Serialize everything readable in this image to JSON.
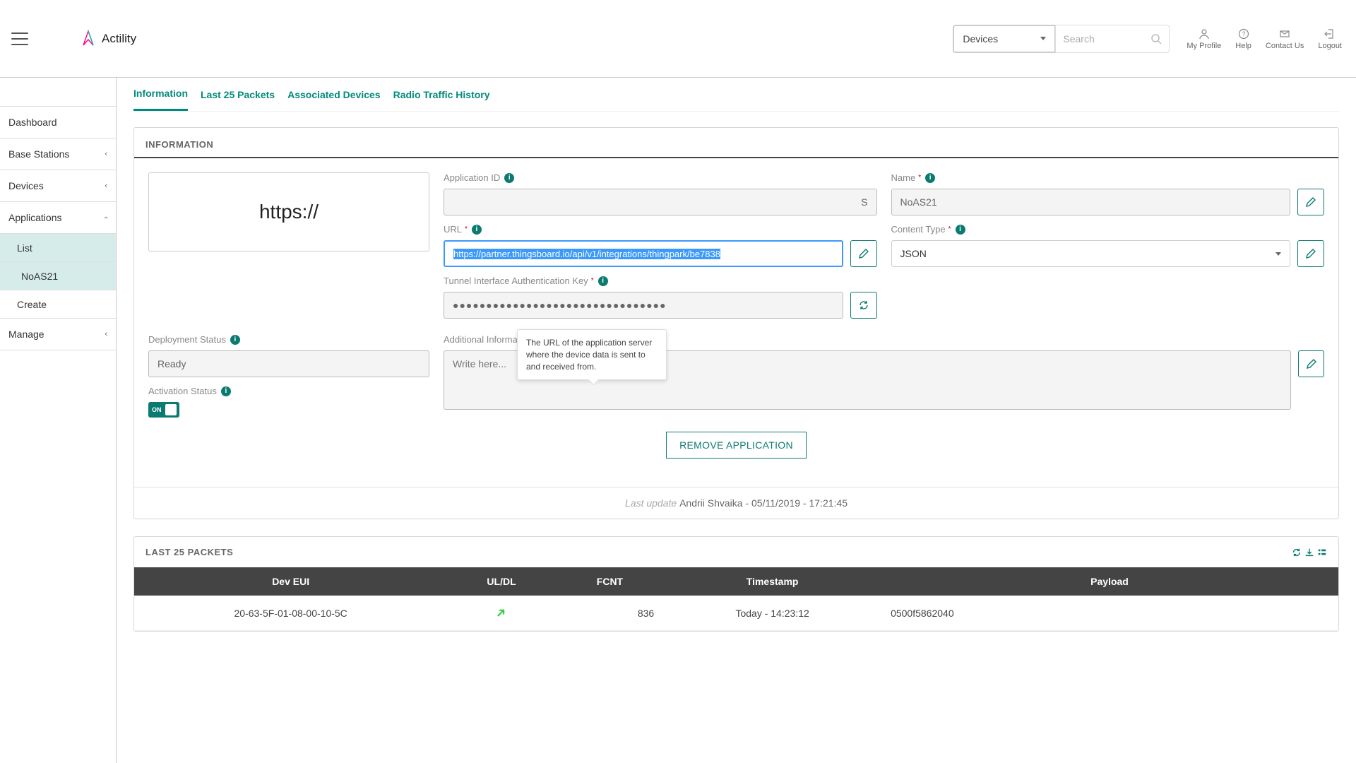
{
  "brand": "Actility",
  "topbar": {
    "device_select": "Devices",
    "search_placeholder": "Search",
    "actions": {
      "profile": "My Profile",
      "help": "Help",
      "contact": "Contact Us",
      "logout": "Logout"
    }
  },
  "sidebar": {
    "dashboard": "Dashboard",
    "base_stations": "Base Stations",
    "devices": "Devices",
    "applications": "Applications",
    "apps_sub": {
      "list": "List",
      "detail": "NoAS21",
      "create": "Create"
    },
    "manage": "Manage"
  },
  "tabs": {
    "information": "Information",
    "last25": "Last 25 Packets",
    "associated": "Associated Devices",
    "radio": "Radio Traffic History"
  },
  "info_panel": {
    "title": "INFORMATION",
    "protocol_label": "https://",
    "app_id_label": "Application ID",
    "app_id_value": "S",
    "name_label": "Name",
    "name_value": "NoAS21",
    "url_label": "URL",
    "url_value": "https://partner.thingsboard.io/api/v1/integrations/thingpark/be7838",
    "content_type_label": "Content Type",
    "content_type_value": "JSON",
    "tunnel_label": "Tunnel Interface Authentication Key",
    "tunnel_value": "●●●●●●●●●●●●●●●●●●●●●●●●●●●●●●●●",
    "deploy_label": "Deployment Status",
    "deploy_value": "Ready",
    "activation_label": "Activation Status",
    "activation_toggle": "ON",
    "additional_label": "Additional Information",
    "additional_placeholder": "Write here...",
    "remove_btn": "REMOVE APPLICATION",
    "footer_prefix": "Last update ",
    "footer_value": "Andrii Shvaika - 05/11/2019 - 17:21:45",
    "tooltip": "The URL of the application server where the device data is sent to and received from."
  },
  "packets": {
    "title": "LAST 25 PACKETS",
    "columns": {
      "dev_eui": "Dev EUI",
      "uldl": "UL/DL",
      "fcnt": "FCNT",
      "timestamp": "Timestamp",
      "payload": "Payload"
    },
    "row": {
      "dev_eui": "20-63-5F-01-08-00-10-5C",
      "fcnt": "836",
      "timestamp": "Today - 14:23:12",
      "payload": "0500f5862040"
    }
  }
}
